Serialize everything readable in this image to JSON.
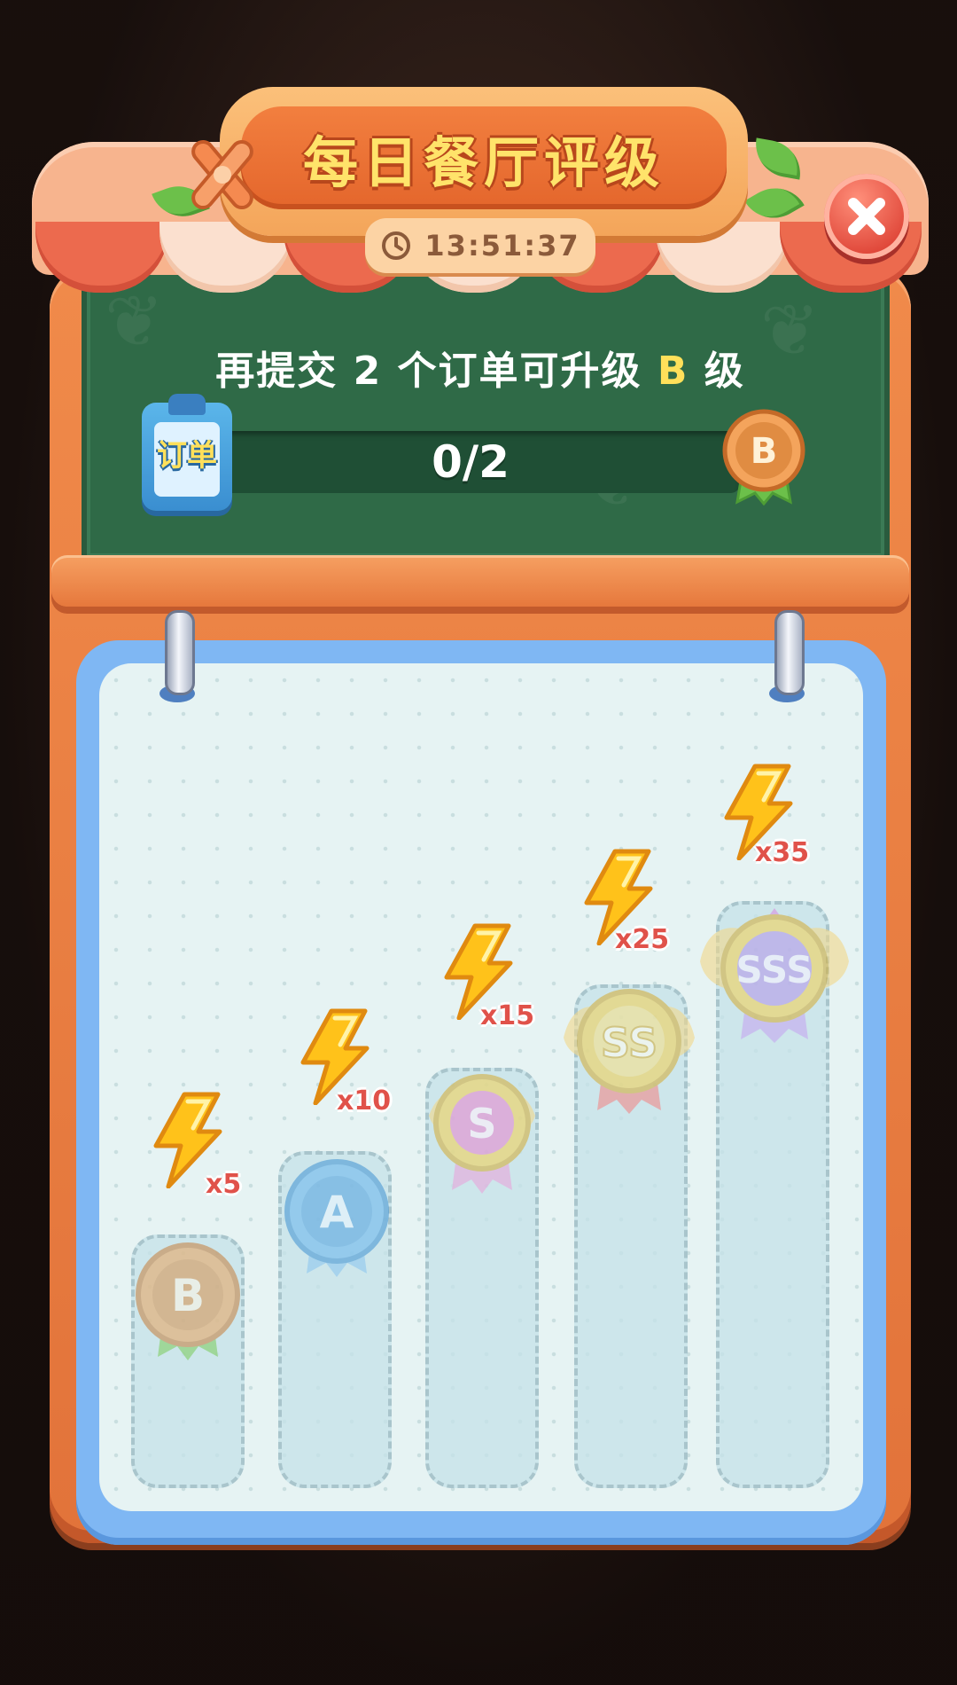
{
  "header": {
    "title": "每日餐厅评级",
    "timer": "13:51:37",
    "close_icon": "close-icon"
  },
  "progress": {
    "hint_prefix": "再提交",
    "hint_count": "2",
    "hint_middle": "个订单可升级",
    "hint_grade": "B",
    "hint_suffix": "级",
    "order_label": "订单",
    "text": "0/2",
    "current": 0,
    "target": 2,
    "next_grade": "B"
  },
  "tiers": [
    {
      "grade": "B",
      "reward": "x5"
    },
    {
      "grade": "A",
      "reward": "x10"
    },
    {
      "grade": "S",
      "reward": "x15"
    },
    {
      "grade": "SS",
      "reward": "x25"
    },
    {
      "grade": "SSS",
      "reward": "x35"
    }
  ],
  "colors": {
    "energy": "#ffc21a",
    "grade_b": "#e9a25a",
    "grade_a": "#6fb8ee",
    "grade_s": "#e58bd0",
    "grade_ss": "#f0d15c",
    "grade_sss": "#b59be8"
  }
}
